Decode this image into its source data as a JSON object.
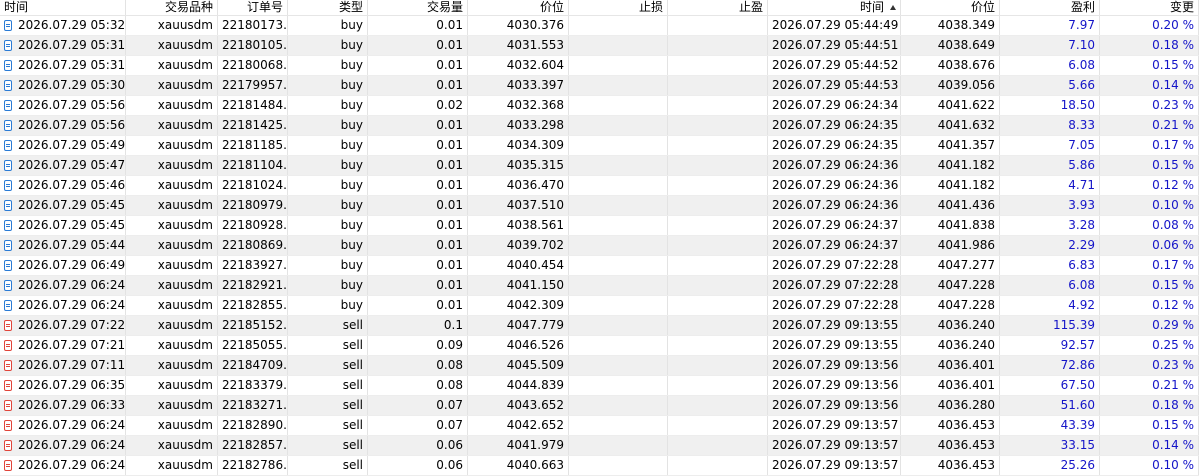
{
  "headers": {
    "open_time": "时间",
    "symbol": "交易品种",
    "ticket": "订单号",
    "type": "类型",
    "volume": "交易量",
    "open_price": "价位",
    "sl": "止损",
    "tp": "止盈",
    "close_time": "时间",
    "close_price": "价位",
    "profit": "盈利",
    "change": "变更"
  },
  "sort": {
    "column": "close_time",
    "direction": "ascending"
  },
  "colors": {
    "buy_icon": "#2a7bd5",
    "sell_icon": "#e0443a",
    "value_blue": "#1414c8",
    "alt_row": "#f0f0f0"
  },
  "rows": [
    {
      "icon": "buy-deal-icon",
      "open_time": "2026.07.29 05:32:...",
      "symbol": "xauusdm",
      "ticket": "22180173...",
      "type": "buy",
      "volume": "0.01",
      "open_price": "4030.376",
      "sl": "",
      "tp": "",
      "close_time": "2026.07.29 05:44:49",
      "close_price": "4038.349",
      "profit": "7.97",
      "change": "0.20 %"
    },
    {
      "icon": "buy-deal-icon",
      "open_time": "2026.07.29 05:31:...",
      "symbol": "xauusdm",
      "ticket": "22180105...",
      "type": "buy",
      "volume": "0.01",
      "open_price": "4031.553",
      "sl": "",
      "tp": "",
      "close_time": "2026.07.29 05:44:51",
      "close_price": "4038.649",
      "profit": "7.10",
      "change": "0.18 %"
    },
    {
      "icon": "buy-deal-icon",
      "open_time": "2026.07.29 05:31:...",
      "symbol": "xauusdm",
      "ticket": "22180068...",
      "type": "buy",
      "volume": "0.01",
      "open_price": "4032.604",
      "sl": "",
      "tp": "",
      "close_time": "2026.07.29 05:44:52",
      "close_price": "4038.676",
      "profit": "6.08",
      "change": "0.15 %"
    },
    {
      "icon": "buy-deal-icon",
      "open_time": "2026.07.29 05:30:...",
      "symbol": "xauusdm",
      "ticket": "22179957...",
      "type": "buy",
      "volume": "0.01",
      "open_price": "4033.397",
      "sl": "",
      "tp": "",
      "close_time": "2026.07.29 05:44:53",
      "close_price": "4039.056",
      "profit": "5.66",
      "change": "0.14 %"
    },
    {
      "icon": "buy-deal-icon",
      "open_time": "2026.07.29 05:56:...",
      "symbol": "xauusdm",
      "ticket": "22181484...",
      "type": "buy",
      "volume": "0.02",
      "open_price": "4032.368",
      "sl": "",
      "tp": "",
      "close_time": "2026.07.29 06:24:34",
      "close_price": "4041.622",
      "profit": "18.50",
      "change": "0.23 %"
    },
    {
      "icon": "buy-deal-icon",
      "open_time": "2026.07.29 05:56:...",
      "symbol": "xauusdm",
      "ticket": "22181425...",
      "type": "buy",
      "volume": "0.01",
      "open_price": "4033.298",
      "sl": "",
      "tp": "",
      "close_time": "2026.07.29 06:24:35",
      "close_price": "4041.632",
      "profit": "8.33",
      "change": "0.21 %"
    },
    {
      "icon": "buy-deal-icon",
      "open_time": "2026.07.29 05:49:...",
      "symbol": "xauusdm",
      "ticket": "22181185...",
      "type": "buy",
      "volume": "0.01",
      "open_price": "4034.309",
      "sl": "",
      "tp": "",
      "close_time": "2026.07.29 06:24:35",
      "close_price": "4041.357",
      "profit": "7.05",
      "change": "0.17 %"
    },
    {
      "icon": "buy-deal-icon",
      "open_time": "2026.07.29 05:47:...",
      "symbol": "xauusdm",
      "ticket": "22181104...",
      "type": "buy",
      "volume": "0.01",
      "open_price": "4035.315",
      "sl": "",
      "tp": "",
      "close_time": "2026.07.29 06:24:36",
      "close_price": "4041.182",
      "profit": "5.86",
      "change": "0.15 %"
    },
    {
      "icon": "buy-deal-icon",
      "open_time": "2026.07.29 05:46:...",
      "symbol": "xauusdm",
      "ticket": "22181024...",
      "type": "buy",
      "volume": "0.01",
      "open_price": "4036.470",
      "sl": "",
      "tp": "",
      "close_time": "2026.07.29 06:24:36",
      "close_price": "4041.182",
      "profit": "4.71",
      "change": "0.12 %"
    },
    {
      "icon": "buy-deal-icon",
      "open_time": "2026.07.29 05:45:...",
      "symbol": "xauusdm",
      "ticket": "22180979...",
      "type": "buy",
      "volume": "0.01",
      "open_price": "4037.510",
      "sl": "",
      "tp": "",
      "close_time": "2026.07.29 06:24:36",
      "close_price": "4041.436",
      "profit": "3.93",
      "change": "0.10 %"
    },
    {
      "icon": "buy-deal-icon",
      "open_time": "2026.07.29 05:45:...",
      "symbol": "xauusdm",
      "ticket": "22180928...",
      "type": "buy",
      "volume": "0.01",
      "open_price": "4038.561",
      "sl": "",
      "tp": "",
      "close_time": "2026.07.29 06:24:37",
      "close_price": "4041.838",
      "profit": "3.28",
      "change": "0.08 %"
    },
    {
      "icon": "buy-deal-icon",
      "open_time": "2026.07.29 05:44:...",
      "symbol": "xauusdm",
      "ticket": "22180869...",
      "type": "buy",
      "volume": "0.01",
      "open_price": "4039.702",
      "sl": "",
      "tp": "",
      "close_time": "2026.07.29 06:24:37",
      "close_price": "4041.986",
      "profit": "2.29",
      "change": "0.06 %"
    },
    {
      "icon": "buy-deal-icon",
      "open_time": "2026.07.29 06:49:...",
      "symbol": "xauusdm",
      "ticket": "22183927...",
      "type": "buy",
      "volume": "0.01",
      "open_price": "4040.454",
      "sl": "",
      "tp": "",
      "close_time": "2026.07.29 07:22:28",
      "close_price": "4047.277",
      "profit": "6.83",
      "change": "0.17 %"
    },
    {
      "icon": "buy-deal-icon",
      "open_time": "2026.07.29 06:24:...",
      "symbol": "xauusdm",
      "ticket": "22182921...",
      "type": "buy",
      "volume": "0.01",
      "open_price": "4041.150",
      "sl": "",
      "tp": "",
      "close_time": "2026.07.29 07:22:28",
      "close_price": "4047.228",
      "profit": "6.08",
      "change": "0.15 %"
    },
    {
      "icon": "buy-deal-icon",
      "open_time": "2026.07.29 06:24:...",
      "symbol": "xauusdm",
      "ticket": "22182855...",
      "type": "buy",
      "volume": "0.01",
      "open_price": "4042.309",
      "sl": "",
      "tp": "",
      "close_time": "2026.07.29 07:22:28",
      "close_price": "4047.228",
      "profit": "4.92",
      "change": "0.12 %"
    },
    {
      "icon": "sell-deal-icon",
      "open_time": "2026.07.29 07:22:...",
      "symbol": "xauusdm",
      "ticket": "22185152...",
      "type": "sell",
      "volume": "0.1",
      "open_price": "4047.779",
      "sl": "",
      "tp": "",
      "close_time": "2026.07.29 09:13:55",
      "close_price": "4036.240",
      "profit": "115.39",
      "change": "0.29 %"
    },
    {
      "icon": "sell-deal-icon",
      "open_time": "2026.07.29 07:21:...",
      "symbol": "xauusdm",
      "ticket": "22185055...",
      "type": "sell",
      "volume": "0.09",
      "open_price": "4046.526",
      "sl": "",
      "tp": "",
      "close_time": "2026.07.29 09:13:55",
      "close_price": "4036.240",
      "profit": "92.57",
      "change": "0.25 %"
    },
    {
      "icon": "sell-deal-icon",
      "open_time": "2026.07.29 07:11:...",
      "symbol": "xauusdm",
      "ticket": "22184709...",
      "type": "sell",
      "volume": "0.08",
      "open_price": "4045.509",
      "sl": "",
      "tp": "",
      "close_time": "2026.07.29 09:13:56",
      "close_price": "4036.401",
      "profit": "72.86",
      "change": "0.23 %"
    },
    {
      "icon": "sell-deal-icon",
      "open_time": "2026.07.29 06:35:...",
      "symbol": "xauusdm",
      "ticket": "22183379...",
      "type": "sell",
      "volume": "0.08",
      "open_price": "4044.839",
      "sl": "",
      "tp": "",
      "close_time": "2026.07.29 09:13:56",
      "close_price": "4036.401",
      "profit": "67.50",
      "change": "0.21 %"
    },
    {
      "icon": "sell-deal-icon",
      "open_time": "2026.07.29 06:33:...",
      "symbol": "xauusdm",
      "ticket": "22183271...",
      "type": "sell",
      "volume": "0.07",
      "open_price": "4043.652",
      "sl": "",
      "tp": "",
      "close_time": "2026.07.29 09:13:56",
      "close_price": "4036.280",
      "profit": "51.60",
      "change": "0.18 %"
    },
    {
      "icon": "sell-deal-icon",
      "open_time": "2026.07.29 06:24:...",
      "symbol": "xauusdm",
      "ticket": "22182890...",
      "type": "sell",
      "volume": "0.07",
      "open_price": "4042.652",
      "sl": "",
      "tp": "",
      "close_time": "2026.07.29 09:13:57",
      "close_price": "4036.453",
      "profit": "43.39",
      "change": "0.15 %"
    },
    {
      "icon": "sell-deal-icon",
      "open_time": "2026.07.29 06:24:...",
      "symbol": "xauusdm",
      "ticket": "22182857...",
      "type": "sell",
      "volume": "0.06",
      "open_price": "4041.979",
      "sl": "",
      "tp": "",
      "close_time": "2026.07.29 09:13:57",
      "close_price": "4036.453",
      "profit": "33.15",
      "change": "0.14 %"
    },
    {
      "icon": "sell-deal-icon",
      "open_time": "2026.07.29 06:24:...",
      "symbol": "xauusdm",
      "ticket": "22182786...",
      "type": "sell",
      "volume": "0.06",
      "open_price": "4040.663",
      "sl": "",
      "tp": "",
      "close_time": "2026.07.29 09:13:57",
      "close_price": "4036.453",
      "profit": "25.26",
      "change": "0.10 %"
    }
  ]
}
